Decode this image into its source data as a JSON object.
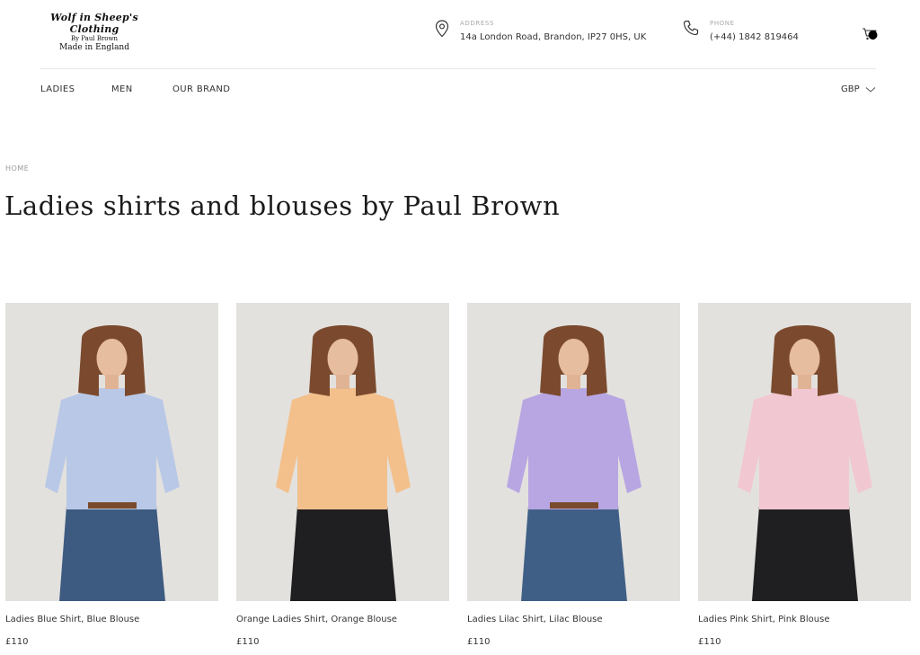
{
  "brand": {
    "line1": "Wolf in Sheep's Clothing",
    "line2": "By Paul Brown",
    "line3": "Made in England"
  },
  "contact": {
    "address_label": "ADDRESS",
    "address_value": "14a London Road, Brandon, IP27 0HS, UK",
    "phone_label": "PHONE",
    "phone_value": "(+44) 1842 819464"
  },
  "nav": {
    "items": [
      "LADIES",
      "MEN",
      "OUR BRAND"
    ],
    "currency": "GBP"
  },
  "breadcrumb": "HOME",
  "page_title": "Ladies shirts and blouses by Paul Brown",
  "products": [
    {
      "name": "Ladies Blue Shirt, Blue Blouse",
      "price": "£110",
      "shirt_color": "#b9c8e6",
      "trouser_color": "#3d5a80"
    },
    {
      "name": "Orange Ladies Shirt, Orange Blouse",
      "price": "£110",
      "shirt_color": "#f3c08c",
      "trouser_color": "#1f1f22"
    },
    {
      "name": "Ladies Lilac Shirt, Lilac Blouse",
      "price": "£110",
      "shirt_color": "#b8a6e3",
      "trouser_color": "#3f5f86"
    },
    {
      "name": "Ladies Pink Shirt, Pink Blouse",
      "price": "£110",
      "shirt_color": "#f1c8d2",
      "trouser_color": "#1f1f22"
    }
  ],
  "icons": {
    "address": "map-pin-icon",
    "phone": "phone-icon",
    "cart": "cart-icon",
    "currency": "chevron-down-icon"
  }
}
